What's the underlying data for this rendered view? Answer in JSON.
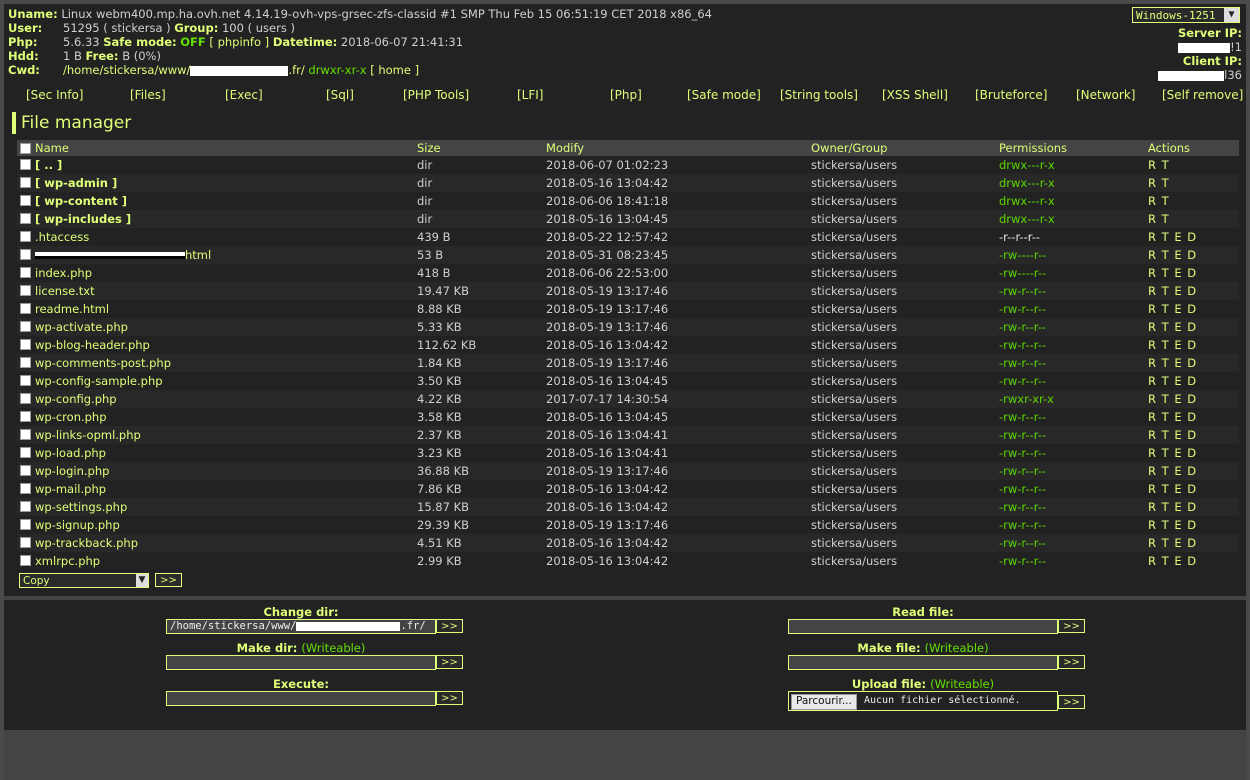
{
  "header": {
    "uname_label": "Uname:",
    "uname_value": "Linux webm400.mp.ha.ovh.net 4.14.19-ovh-vps-grsec-zfs-classid #1 SMP Thu Feb 15 06:51:19 CET 2018 x86_64",
    "user_label": "User:",
    "user_value": "51295 ( stickersa )",
    "group_label": "Group:",
    "group_value": "100 ( users )",
    "php_label": "Php:",
    "php_version": "5.6.33",
    "safe_mode_label": "Safe mode:",
    "safe_mode_value": "OFF",
    "phpinfo_link": "[ phpinfo ]",
    "datetime_label": "Datetime:",
    "datetime_value": "2018-06-07 21:41:31",
    "hdd_label": "Hdd:",
    "hdd_value": "1 B",
    "free_label": "Free:",
    "free_value": "B (0%)",
    "cwd_label": "Cwd:",
    "cwd_prefix": "/home/stickersa/www/",
    "cwd_suffix": ".fr/",
    "cwd_perms": "drwxr-xr-x",
    "home_link": "[ home ]",
    "encoding": "Windows-1251",
    "server_ip_label": "Server IP:",
    "server_ip_tail": "!1",
    "client_ip_label": "Client IP:",
    "client_ip_tail": "l36"
  },
  "nav": [
    "[Sec Info]",
    "[Files]",
    "[Exec]",
    "[Sql]",
    "[PHP Tools]",
    "[LFI]",
    "[Php]",
    "[Safe mode]",
    "[String tools]",
    "[XSS Shell]",
    "[Bruteforce]",
    "[Network]",
    "[Self remove]"
  ],
  "file_manager": {
    "title": "File manager",
    "columns": {
      "name": "Name",
      "size": "Size",
      "modify": "Modify",
      "owner": "Owner/Group",
      "permissions": "Permissions",
      "actions": "Actions"
    },
    "rows": [
      {
        "name": "[ .. ]",
        "size": "dir",
        "modify": "2018-06-07 01:02:23",
        "owner": "stickersa/users",
        "perms": "drwx---r-x",
        "actions": "R T"
      },
      {
        "name": "[ wp-admin ]",
        "size": "dir",
        "modify": "2018-05-16 13:04:42",
        "owner": "stickersa/users",
        "perms": "drwx---r-x",
        "actions": "R T"
      },
      {
        "name": "[ wp-content ]",
        "size": "dir",
        "modify": "2018-06-06 18:41:18",
        "owner": "stickersa/users",
        "perms": "drwx---r-x",
        "actions": "R T"
      },
      {
        "name": "[ wp-includes ]",
        "size": "dir",
        "modify": "2018-05-16 13:04:45",
        "owner": "stickersa/users",
        "perms": "drwx---r-x",
        "actions": "R T"
      },
      {
        "name": ".htaccess",
        "size": "439 B",
        "modify": "2018-05-22 12:57:42",
        "owner": "stickersa/users",
        "perms": "-r--r--r--",
        "actions": "R T E D"
      },
      {
        "name": "html",
        "size": "53 B",
        "modify": "2018-05-31 08:23:45",
        "owner": "stickersa/users",
        "perms": "-rw----r--",
        "actions": "R T E D"
      },
      {
        "name": "index.php",
        "size": "418 B",
        "modify": "2018-06-06 22:53:00",
        "owner": "stickersa/users",
        "perms": "-rw----r--",
        "actions": "R T E D"
      },
      {
        "name": "license.txt",
        "size": "19.47 KB",
        "modify": "2018-05-19 13:17:46",
        "owner": "stickersa/users",
        "perms": "-rw-r--r--",
        "actions": "R T E D"
      },
      {
        "name": "readme.html",
        "size": "8.88 KB",
        "modify": "2018-05-19 13:17:46",
        "owner": "stickersa/users",
        "perms": "-rw-r--r--",
        "actions": "R T E D"
      },
      {
        "name": "wp-activate.php",
        "size": "5.33 KB",
        "modify": "2018-05-19 13:17:46",
        "owner": "stickersa/users",
        "perms": "-rw-r--r--",
        "actions": "R T E D"
      },
      {
        "name": "wp-blog-header.php",
        "size": "112.62 KB",
        "modify": "2018-05-16 13:04:42",
        "owner": "stickersa/users",
        "perms": "-rw-r--r--",
        "actions": "R T E D"
      },
      {
        "name": "wp-comments-post.php",
        "size": "1.84 KB",
        "modify": "2018-05-19 13:17:46",
        "owner": "stickersa/users",
        "perms": "-rw-r--r--",
        "actions": "R T E D"
      },
      {
        "name": "wp-config-sample.php",
        "size": "3.50 KB",
        "modify": "2018-05-16 13:04:45",
        "owner": "stickersa/users",
        "perms": "-rw-r--r--",
        "actions": "R T E D"
      },
      {
        "name": "wp-config.php",
        "size": "4.22 KB",
        "modify": "2017-07-17 14:30:54",
        "owner": "stickersa/users",
        "perms": "-rwxr-xr-x",
        "actions": "R T E D"
      },
      {
        "name": "wp-cron.php",
        "size": "3.58 KB",
        "modify": "2018-05-16 13:04:45",
        "owner": "stickersa/users",
        "perms": "-rw-r--r--",
        "actions": "R T E D"
      },
      {
        "name": "wp-links-opml.php",
        "size": "2.37 KB",
        "modify": "2018-05-16 13:04:41",
        "owner": "stickersa/users",
        "perms": "-rw-r--r--",
        "actions": "R T E D"
      },
      {
        "name": "wp-load.php",
        "size": "3.23 KB",
        "modify": "2018-05-16 13:04:41",
        "owner": "stickersa/users",
        "perms": "-rw-r--r--",
        "actions": "R T E D"
      },
      {
        "name": "wp-login.php",
        "size": "36.88 KB",
        "modify": "2018-05-19 13:17:46",
        "owner": "stickersa/users",
        "perms": "-rw-r--r--",
        "actions": "R T E D"
      },
      {
        "name": "wp-mail.php",
        "size": "7.86 KB",
        "modify": "2018-05-16 13:04:42",
        "owner": "stickersa/users",
        "perms": "-rw-r--r--",
        "actions": "R T E D"
      },
      {
        "name": "wp-settings.php",
        "size": "15.87 KB",
        "modify": "2018-05-16 13:04:42",
        "owner": "stickersa/users",
        "perms": "-rw-r--r--",
        "actions": "R T E D"
      },
      {
        "name": "wp-signup.php",
        "size": "29.39 KB",
        "modify": "2018-05-19 13:17:46",
        "owner": "stickersa/users",
        "perms": "-rw-r--r--",
        "actions": "R T E D"
      },
      {
        "name": "wp-trackback.php",
        "size": "4.51 KB",
        "modify": "2018-05-16 13:04:42",
        "owner": "stickersa/users",
        "perms": "-rw-r--r--",
        "actions": "R T E D"
      },
      {
        "name": "xmlrpc.php",
        "size": "2.99 KB",
        "modify": "2018-05-16 13:04:42",
        "owner": "stickersa/users",
        "perms": "-rw-r--r--",
        "actions": "R T E D"
      }
    ],
    "bulk_action": "Copy",
    "go_label": ">>"
  },
  "forms": {
    "change_dir_label": "Change dir:",
    "change_dir_prefix": "/home/stickersa/www/",
    "change_dir_suffix": ".fr/",
    "make_dir_label": "Make dir:",
    "execute_label": "Execute:",
    "read_file_label": "Read file:",
    "make_file_label": "Make file:",
    "upload_file_label": "Upload file:",
    "writeable_note": "(Writeable)",
    "browse_button": "Parcourir...",
    "no_file_selected": "Aucun fichier sélectionné.",
    "go_label": ">>"
  },
  "colors": {
    "accent": "#dfff79",
    "ok": "#66e000",
    "bg": "#222222"
  }
}
